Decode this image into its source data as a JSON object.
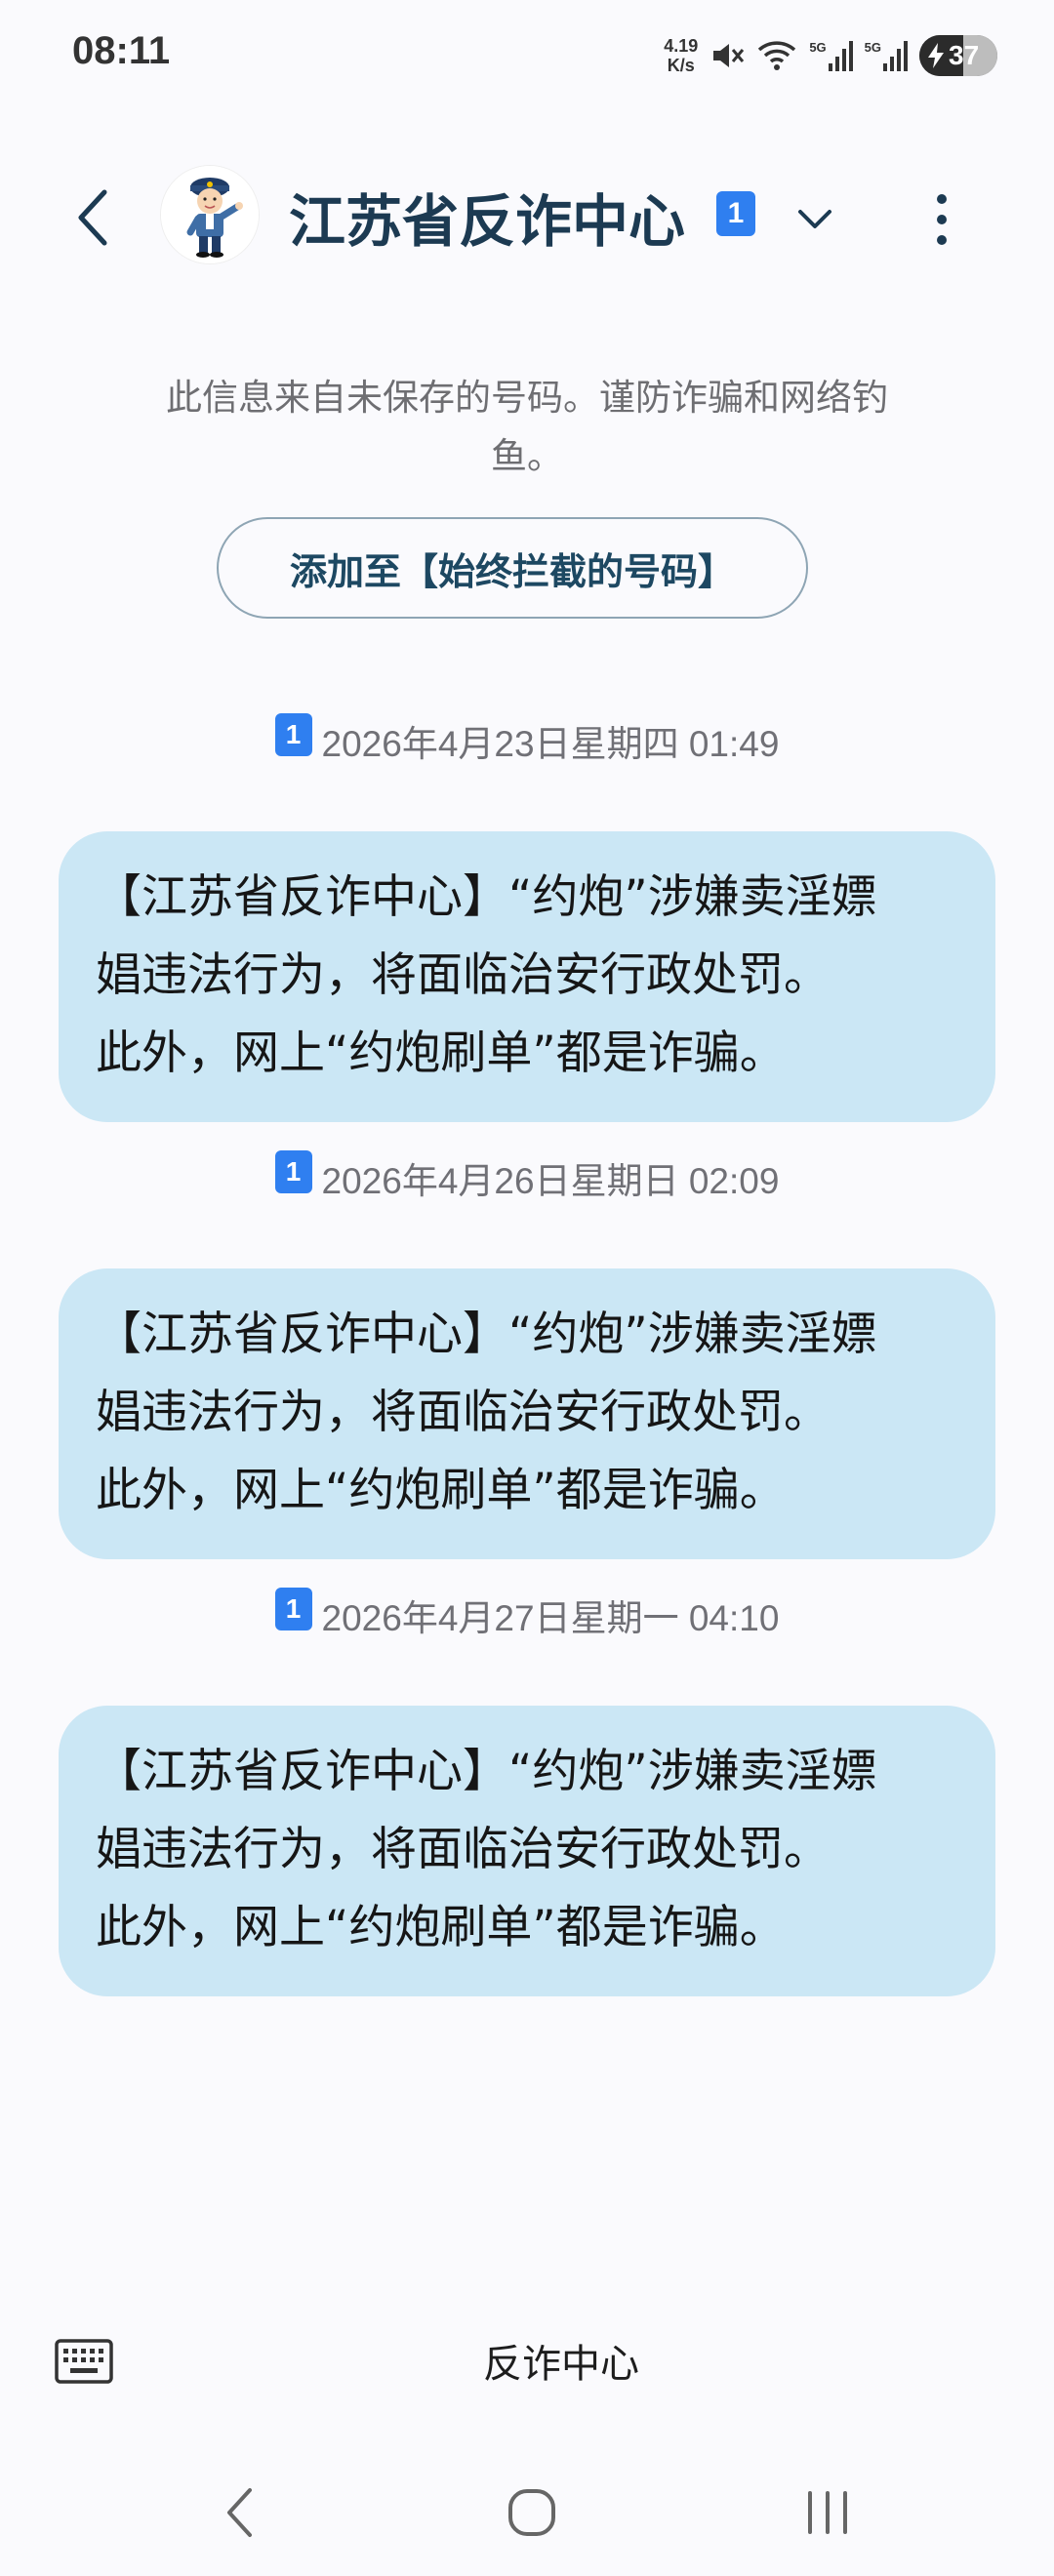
{
  "status_bar": {
    "time": "08:11",
    "net_speed_value": "4.19",
    "net_speed_unit": "K/s",
    "signal1_label": "5G",
    "signal2_label": "5G",
    "battery_percent": "37",
    "battery_level": 0.37
  },
  "header": {
    "title": "江苏省反诈中心",
    "sim_slot": "1"
  },
  "notice": {
    "text": "此信息来自未保存的号码。谨防诈骗和网络钓鱼。",
    "block_button": "添加至【始终拦截的号码】"
  },
  "messages": [
    {
      "sim": "1",
      "timestamp": "2026年4月23日星期四 01:49",
      "line1": "【江苏省反诈中心】“约炮”涉嫌卖淫嫖",
      "line2": "娼违法行为，将面临治安行政处罚。",
      "line3": "此外，网上“约炮刷单”都是诈骗。"
    },
    {
      "sim": "1",
      "timestamp": "2026年4月26日星期日 02:09",
      "line1": "【江苏省反诈中心】“约炮”涉嫌卖淫嫖",
      "line2": "娼违法行为，将面临治安行政处罚。",
      "line3": "此外，网上“约炮刷单”都是诈骗。"
    },
    {
      "sim": "1",
      "timestamp": "2026年4月27日星期一 04:10",
      "line1": "【江苏省反诈中心】“约炮”涉嫌卖淫嫖",
      "line2": "娼违法行为，将面临治安行政处罚。",
      "line3": "此外，网上“约炮刷单”都是诈骗。"
    }
  ],
  "input_bar": {
    "text": "反诈中心"
  },
  "colors": {
    "bubble": "#cbe7f5",
    "sim_badge": "#2f7ff0",
    "title": "#1c3a52"
  }
}
